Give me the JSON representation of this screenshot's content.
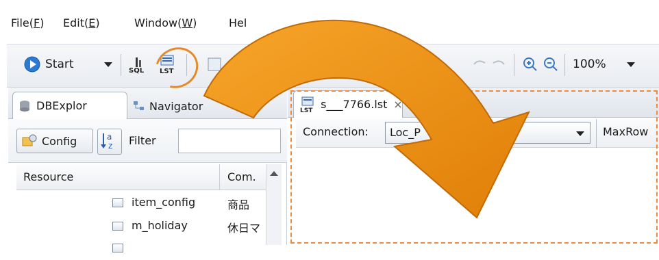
{
  "menubar": {
    "items": [
      {
        "label": "File(",
        "key": "F",
        "suffix": ")"
      },
      {
        "label": "Edit(",
        "key": "E",
        "suffix": ")"
      },
      {
        "label": "Window(",
        "key": "W",
        "suffix": ")"
      },
      {
        "label": "Hel",
        "key": "",
        "suffix": ""
      }
    ]
  },
  "toolbar": {
    "start_label": "Start",
    "zoom_value": "100%"
  },
  "left_panel": {
    "tabs": [
      "DBExplor",
      "Navigator"
    ],
    "config_label": "Config",
    "sort_label": "az",
    "filter_label": "Filter",
    "filter_value": "",
    "columns": [
      "Resource",
      "Com."
    ],
    "rows": [
      {
        "name": "item_config",
        "comment": "商品"
      },
      {
        "name": "m_holiday",
        "comment": "休日マ"
      }
    ]
  },
  "editor": {
    "tab_label": "s___7766.lst",
    "connection_label": "Connection:",
    "connection_value": "Loc_P",
    "maxrow_label": "MaxRow"
  },
  "colors": {
    "arrow": "#f29a16",
    "arrow_edge": "#c06a08",
    "highlight": "#e58a2a",
    "play_green": "#2ea043",
    "start_blue": "#2b7bd4"
  }
}
